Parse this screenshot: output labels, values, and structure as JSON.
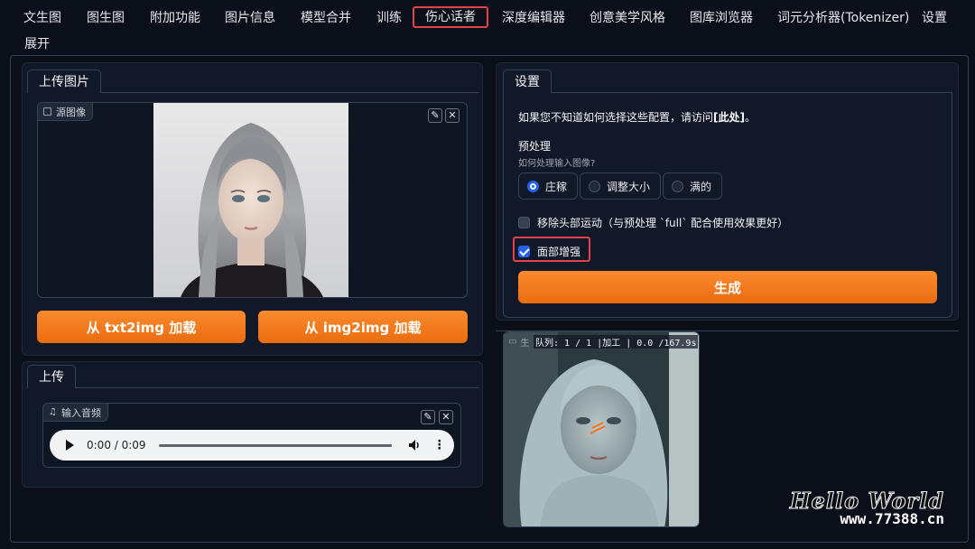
{
  "nav": {
    "tabs": [
      "文生图",
      "图生图",
      "附加功能",
      "图片信息",
      "模型合并",
      "训练",
      "伤心话者",
      "深度编辑器",
      "创意美学风格",
      "图库浏览器",
      "词元分析器(Tokenizer)",
      "设置"
    ],
    "active": "伤心话者",
    "expand": "展开"
  },
  "upload_image": {
    "tab": "上传图片",
    "source_label": "源图像",
    "btn_txt2img": "从 txt2img 加载",
    "btn_img2img": "从 img2img 加载"
  },
  "upload_audio": {
    "tab": "上传",
    "audio_label": "输入音频",
    "time": "0:00 / 0:09"
  },
  "settings": {
    "tab": "设置",
    "hint_prefix": "如果您不知道如何选择这些配置，请访问",
    "hint_link": "[此处]",
    "hint_suffix": "。",
    "preprocess_title": "预处理",
    "preprocess_sub": "如何处理输入图像?",
    "options": [
      "庄稼",
      "调整大小",
      "满的"
    ],
    "selected_option": "庄稼",
    "still_label": "移除头部运动（与预处理 `full` 配合使用效果更好）",
    "still_checked": false,
    "enhance_label": "面部增强",
    "enhance_checked": true,
    "generate": "生成"
  },
  "output": {
    "label": "生",
    "queue": "队列: 1 / 1 |加工 | 0.0 /167.9s"
  },
  "watermark": {
    "line1": "Hello World",
    "line2": "www.77388.cn"
  },
  "colors": {
    "accent": "#f97316",
    "highlight": "#e0434c",
    "checkbox": "#2563eb",
    "background": "#0b0f19"
  }
}
